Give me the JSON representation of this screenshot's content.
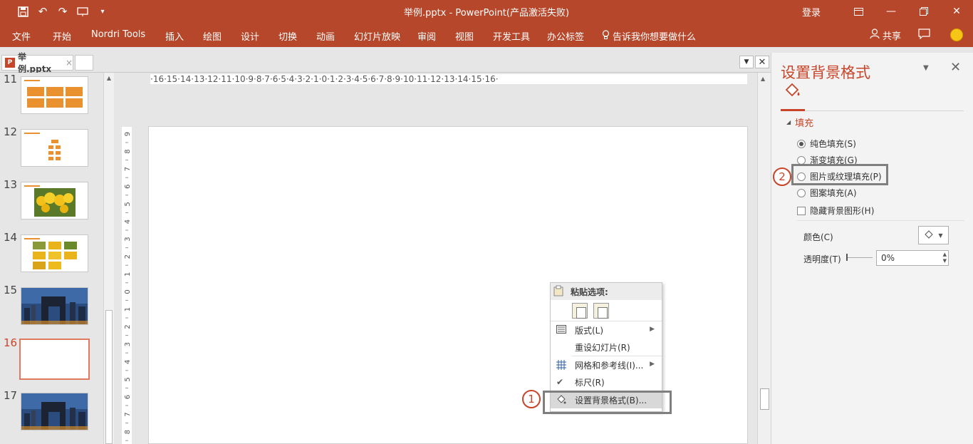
{
  "window": {
    "title": "举例.pptx  -  PowerPoint(产品激活失败)",
    "login": "登录"
  },
  "ribbon": {
    "tabs": [
      "文件",
      "开始",
      "Nordri Tools",
      "插入",
      "绘图",
      "设计",
      "切换",
      "动画",
      "幻灯片放映",
      "审阅",
      "视图",
      "开发工具",
      "办公标签"
    ],
    "tell_me": "告诉我你想要做什么",
    "share": "共享"
  },
  "doc_tab": {
    "name": "举例.pptx",
    "close": "×",
    "pptx_badge": "P"
  },
  "thumbnails": {
    "numbers": [
      "11",
      "12",
      "13",
      "14",
      "15",
      "16",
      "17"
    ],
    "selected": "16"
  },
  "ruler": {
    "horizontal": "·16·15·14·13·12·11·10·9·8·7·6·5·4·3·2·1·0·1·2·3·4·5·6·7·8·9·10·11·12·13·14·15·16·",
    "vertical": [
      "9",
      "8",
      "7",
      "6",
      "5",
      "4",
      "3",
      "2",
      "1",
      "0",
      "1",
      "2",
      "3",
      "4",
      "5",
      "6",
      "7",
      "8"
    ]
  },
  "context_menu": {
    "paste_header": "粘贴选项:",
    "layout": "版式(L)",
    "reset_slide": "重设幻灯片(R)",
    "grid_guides": "网格和参考线(I)...",
    "ruler": "标尺(R)",
    "format_background": "设置背景格式(B)..."
  },
  "annotations": {
    "step1": "1",
    "step2": "2"
  },
  "format_pane": {
    "title": "设置背景格式",
    "section": "填充",
    "options": [
      "纯色填充(S)",
      "渐变填充(G)",
      "图片或纹理填充(P)",
      "图案填充(A)"
    ],
    "selected_option": "纯色填充(S)",
    "hide_background": "隐藏背景图形(H)",
    "color_label": "颜色(C)",
    "transparency_label": "透明度(T)",
    "transparency_value": "0%"
  },
  "colors": {
    "accent": "#b7472a",
    "pane_title": "#c8452a"
  }
}
